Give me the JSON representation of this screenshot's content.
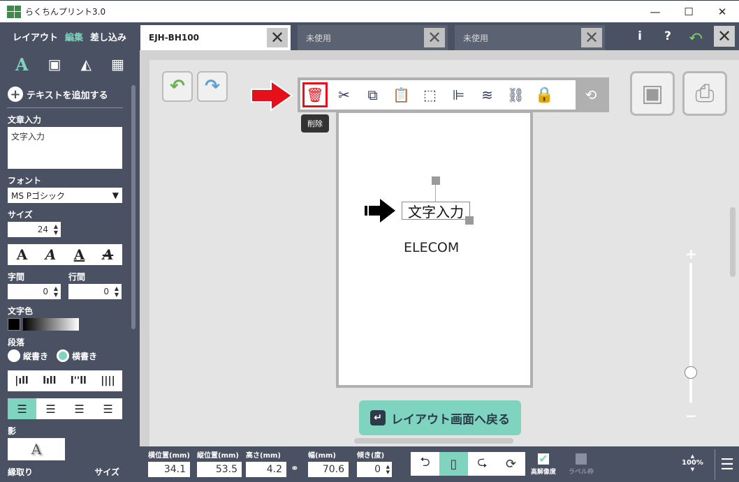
{
  "window": {
    "title": "らくちんプリント3.0",
    "minimize": "—",
    "maximize": "☐",
    "close": "✕"
  },
  "modes": {
    "layout": "レイアウト",
    "edit": "編集",
    "merge": "差し込み"
  },
  "tabs": [
    {
      "label": "EJH-BH100",
      "active": true
    },
    {
      "label": "未使用",
      "active": false
    },
    {
      "label": "未使用",
      "active": false
    }
  ],
  "top_right": {
    "info": "i",
    "help": "?",
    "undo": "⤺",
    "close": "✕"
  },
  "sidebar": {
    "add_text": "テキストを追加する",
    "text_input_label": "文章入力",
    "text_input_value": "文字入力",
    "font_label": "フォント",
    "font_value": "MS Pゴシック",
    "size_label": "サイズ",
    "size_value": "24",
    "char_spacing_label": "字間",
    "char_spacing_value": "0",
    "line_spacing_label": "行間",
    "line_spacing_value": "0",
    "text_color_label": "文字色",
    "paragraph_label": "段落",
    "vertical_label": "縦書き",
    "horizontal_label": "横書き",
    "shadow_label": "影",
    "outline_label": "縁取り",
    "outline_size_label": "サイズ",
    "style_glyph": "A"
  },
  "canvas": {
    "tooltip": "削除",
    "selected_text": "文字入力",
    "elecom_text": "ELECOM",
    "back_button": "レイアウト画面へ戻る",
    "zoom_plus": "+",
    "zoom_minus": "−"
  },
  "bottom": {
    "x_label": "横位置(mm)",
    "x_value": "34.1",
    "y_label": "縦位置(mm)",
    "y_value": "53.5",
    "height_label": "高さ(mm)",
    "height_value": "4.2",
    "width_label": "幅(mm)",
    "width_value": "70.6",
    "tilt_label": "傾き(度)",
    "tilt_value": "0",
    "hires_label": "高解像度",
    "label_frame_label": "ラベル枠",
    "zoom_value": "100%"
  },
  "colors": {
    "accent": "#7fd4c0",
    "panel": "#4a5162",
    "delete_red": "#e6101a"
  }
}
